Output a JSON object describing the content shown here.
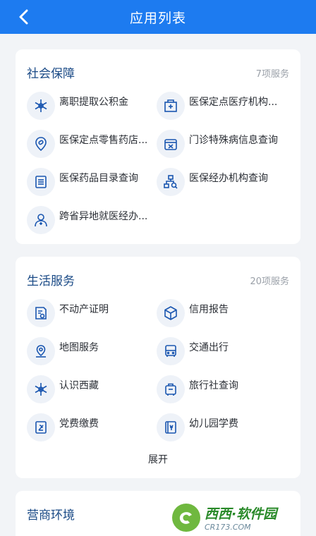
{
  "header": {
    "title": "应用列表"
  },
  "social": {
    "title": "社会保障",
    "count": "7项服务",
    "items": [
      {
        "label": "离职提取公积金",
        "icon": "snowflake-icon"
      },
      {
        "label": "医保定点医疗机构...",
        "icon": "hospital-icon"
      },
      {
        "label": "医保定点零售药店...",
        "icon": "pill-icon"
      },
      {
        "label": "门诊特殊病信息查询",
        "icon": "medical-box-icon"
      },
      {
        "label": "医保药品目录查询",
        "icon": "list-icon"
      },
      {
        "label": "医保经办机构查询",
        "icon": "org-search-icon"
      },
      {
        "label": "跨省异地就医经办...",
        "icon": "doctor-icon"
      }
    ]
  },
  "life": {
    "title": "生活服务",
    "count": "20项服务",
    "items": [
      {
        "label": "不动产证明",
        "icon": "property-doc-icon"
      },
      {
        "label": "信用报告",
        "icon": "cube-icon"
      },
      {
        "label": "地图服务",
        "icon": "map-pin-icon"
      },
      {
        "label": "交通出行",
        "icon": "bus-icon"
      },
      {
        "label": "认识西藏",
        "icon": "snowflake-icon"
      },
      {
        "label": "旅行社查询",
        "icon": "suitcase-icon"
      },
      {
        "label": "党费缴费",
        "icon": "party-emblem-icon"
      },
      {
        "label": "幼儿园学费",
        "icon": "notebook-icon"
      }
    ],
    "expand_label": "展开"
  },
  "business": {
    "title": "营商环境"
  },
  "watermark": {
    "main": "西西·软件园",
    "sub": "CR173.COM"
  },
  "colors": {
    "header": "#1d7bf0",
    "title": "#1a4a86",
    "icon": "#1a56b0"
  }
}
